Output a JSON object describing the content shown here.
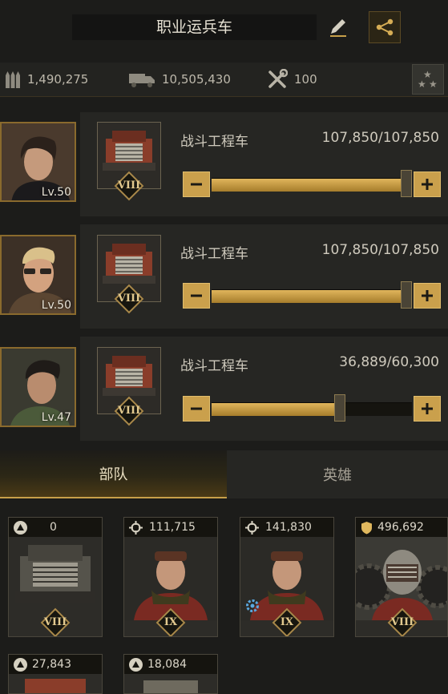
{
  "header": {
    "title": "职业运兵车"
  },
  "stats": {
    "ammo": "1,490,275",
    "trucks": "10,505,430",
    "tools": "100"
  },
  "rows": [
    {
      "name": "战斗工程车",
      "count": "107,850/107,850",
      "level": "Lv.50",
      "tier": "VIII",
      "fill": 1.0
    },
    {
      "name": "战斗工程车",
      "count": "107,850/107,850",
      "level": "Lv.50",
      "tier": "VIII",
      "fill": 1.0
    },
    {
      "name": "战斗工程车",
      "count": "36,889/60,300",
      "level": "Lv.47",
      "tier": "VIII",
      "fill": 0.612
    }
  ],
  "tabs": {
    "troops": "部队",
    "heroes": "英雄"
  },
  "units": [
    {
      "value": "0",
      "tier": "VIII"
    },
    {
      "value": "111,715",
      "tier": "IX"
    },
    {
      "value": "141,830",
      "tier": "IX"
    },
    {
      "value": "496,692",
      "tier": "VIII"
    },
    {
      "value": "27,843"
    },
    {
      "value": "18,084"
    }
  ],
  "colors": {
    "accent": "#caa04c",
    "background": "#1c1c1a",
    "panel": "#262623"
  }
}
